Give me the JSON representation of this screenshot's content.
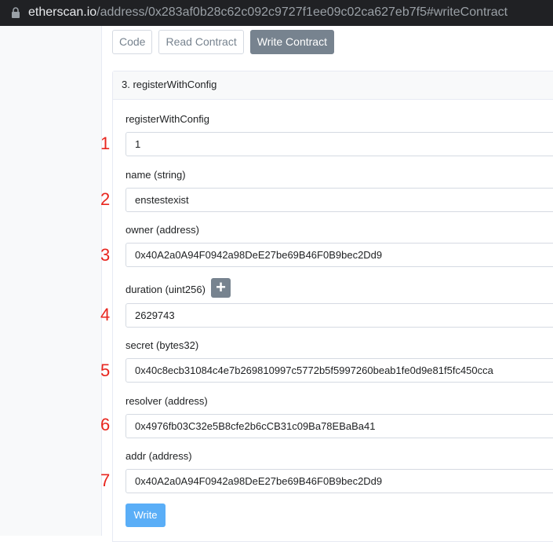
{
  "browser": {
    "url_host": "etherscan.io",
    "url_path": "/address/0x283af0b28c62c092c9727f1ee09c02ca627eb7f5#writeContract"
  },
  "tabs": [
    {
      "label": "Code",
      "active": false
    },
    {
      "label": "Read Contract",
      "active": false
    },
    {
      "label": "Write Contract",
      "active": true
    }
  ],
  "card": {
    "title": "3. registerWithConfig",
    "fields": [
      {
        "number": "1",
        "label": "registerWithConfig",
        "value": "1"
      },
      {
        "number": "2",
        "label": "name (string)",
        "value": "enstestexist"
      },
      {
        "number": "3",
        "label": "owner (address)",
        "value": "0x40A2a0A94F0942a98DeE27be69B46F0B9bec2Dd9"
      },
      {
        "number": "4",
        "label": "duration (uint256)",
        "value": "2629743"
      },
      {
        "number": "5",
        "label": "secret (bytes32)",
        "value": "0x40c8ecb31084c4e7b269810997c5772b5f5997260beab1fe0d9e81f5fc450cca"
      },
      {
        "number": "6",
        "label": "resolver (address)",
        "value": "0x4976fb03C32e5B8cfe2b6cCB31c09Ba78EBaBa41"
      },
      {
        "number": "7",
        "label": "addr (address)",
        "value": "0x40A2a0A94F0942a98DeE27be69B46F0B9bec2Dd9"
      }
    ],
    "plus_label": "+",
    "write_label": "Write"
  },
  "colors": {
    "annotation_red": "#e8261f",
    "write_button": "#5aaef7",
    "active_tab": "#77838f"
  },
  "icons": {
    "lock": "lock-icon",
    "plus": "plus-icon"
  }
}
